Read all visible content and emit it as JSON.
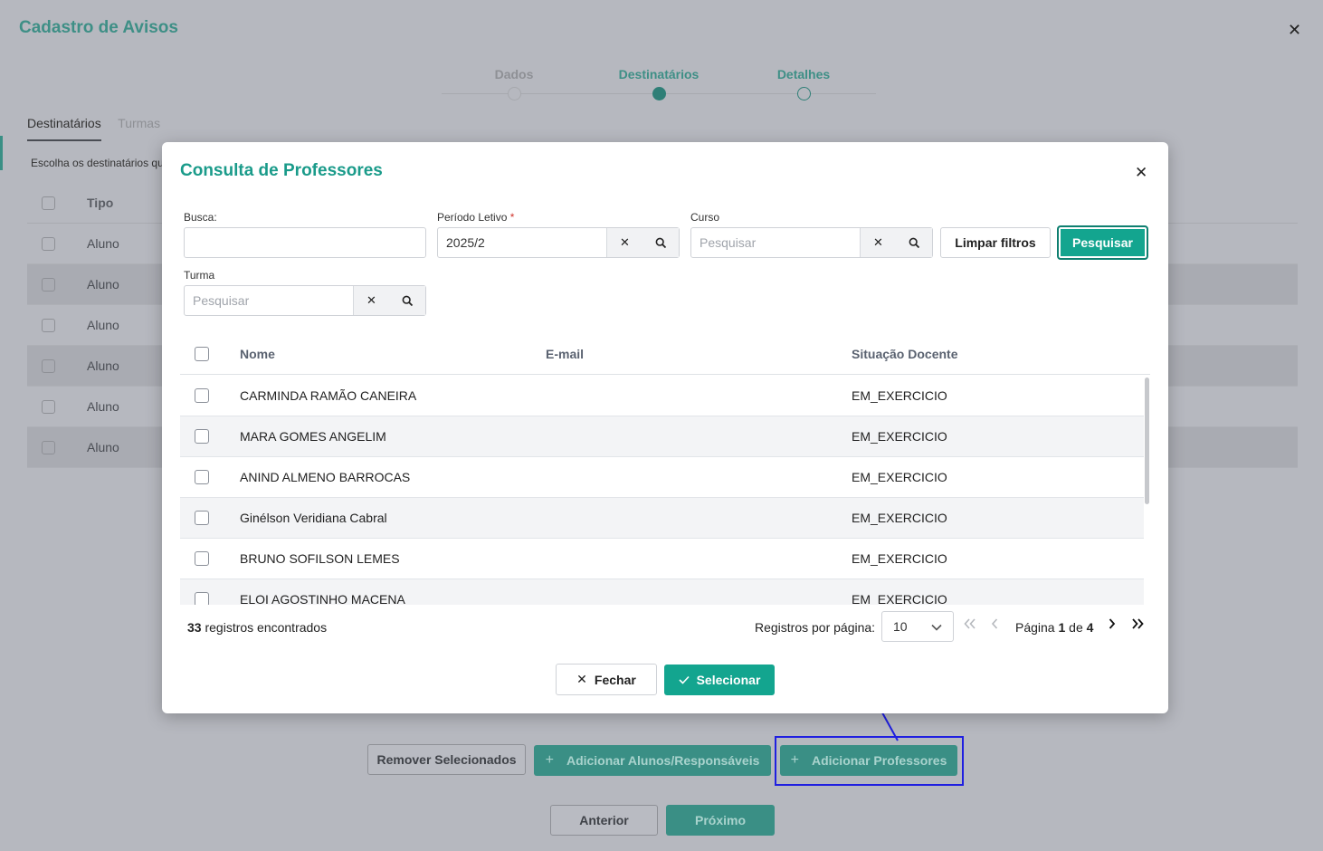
{
  "background": {
    "title": "Cadastro de Avisos",
    "close": "✕",
    "steps": [
      "Dados",
      "Destinatários",
      "Detalhes"
    ],
    "tabs": [
      "Destinatários",
      "Turmas"
    ],
    "description": "Escolha os destinatários qu",
    "table_header": "Tipo",
    "rows": [
      "Aluno",
      "Aluno",
      "Aluno",
      "Aluno",
      "Aluno",
      "Aluno"
    ],
    "buttons": {
      "remover": "Remover Selecionados",
      "add_alunos": "Adicionar Alunos/Responsáveis",
      "add_professores": "Adicionar Professores",
      "anterior": "Anterior",
      "proximo": "Próximo"
    }
  },
  "modal": {
    "title": "Consulta de Professores",
    "close": "✕",
    "filters": {
      "busca_label": "Busca:",
      "busca_value": "",
      "periodo_label": "Período Letivo",
      "periodo_required": "*",
      "periodo_value": "2025/2",
      "curso_label": "Curso",
      "curso_placeholder": "Pesquisar",
      "turma_label": "Turma",
      "turma_placeholder": "Pesquisar",
      "limpar": "Limpar filtros",
      "pesquisar": "Pesquisar"
    },
    "columns": [
      "Nome",
      "E-mail",
      "Situação Docente"
    ],
    "rows": [
      {
        "nome": "CARMINDA RAMÃO CANEIRA",
        "email": "",
        "situacao": "EM_EXERCICIO"
      },
      {
        "nome": "MARA GOMES ANGELIM",
        "email": "",
        "situacao": "EM_EXERCICIO"
      },
      {
        "nome": "ANIND ALMENO BARROCAS",
        "email": "",
        "situacao": "EM_EXERCICIO"
      },
      {
        "nome": "Ginélson Veridiana Cabral",
        "email": "",
        "situacao": "EM_EXERCICIO"
      },
      {
        "nome": "BRUNO SOFILSON LEMES",
        "email": "",
        "situacao": "EM_EXERCICIO"
      },
      {
        "nome": "ELOI AGOSTINHO MACENA",
        "email": "",
        "situacao": "EM_EXERCICIO"
      }
    ],
    "footer": {
      "count": "33",
      "count_text": "registros encontrados",
      "rpp_label": "Registros por página:",
      "rpp_value": "10",
      "page_label": "Página",
      "page_current": "1",
      "page_of": "de",
      "page_total": "4"
    },
    "buttons": {
      "fechar": "Fechar",
      "selecionar": "Selecionar"
    }
  },
  "colors": {
    "accent": "#13a58f",
    "annotation": "#1f1fe0"
  }
}
